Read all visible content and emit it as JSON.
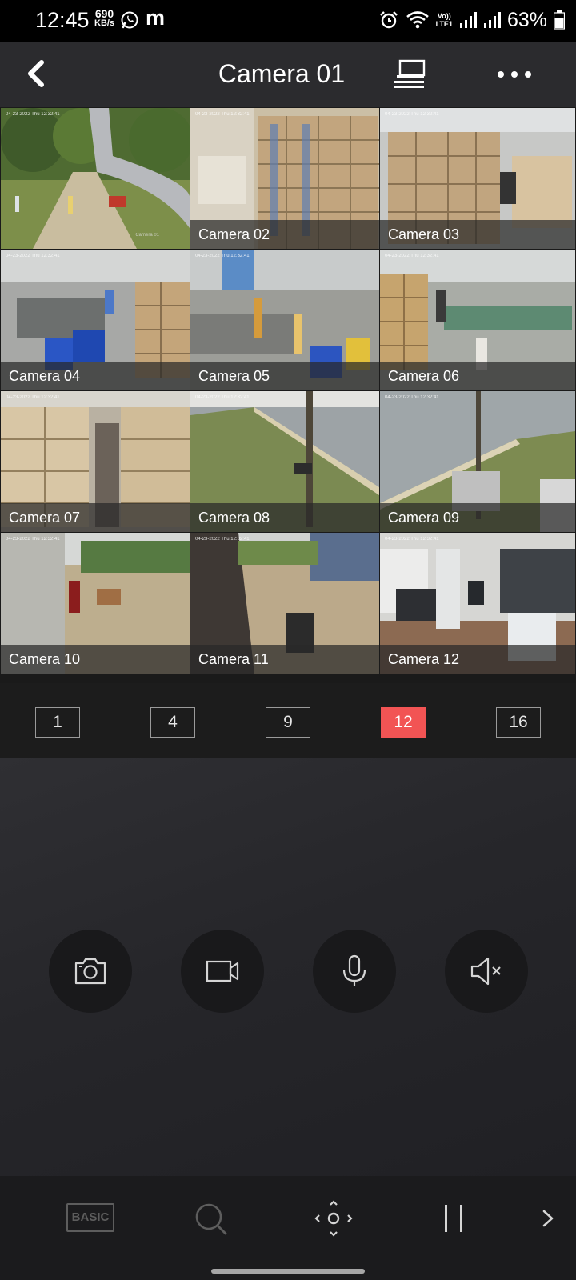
{
  "status_bar": {
    "time": "12:45",
    "net_speed_value": "690",
    "net_speed_unit": "KB/s",
    "app_icon_letter": "m",
    "volte_top": "Vo))",
    "volte_bottom": "LTE1",
    "battery": "63%"
  },
  "header": {
    "title": "Camera 01",
    "icons": [
      "back-icon",
      "monitor-icon",
      "more-icon"
    ]
  },
  "grid": {
    "selected": "Camera 01",
    "timestamp": "04-23-2022 Thu 12:32:41",
    "cells": [
      {
        "label": "",
        "watermark": "Camera 01"
      },
      {
        "label": "Camera 02",
        "watermark": "Camera 02"
      },
      {
        "label": "Camera 03",
        "watermark": "Camera 03"
      },
      {
        "label": "Camera 04",
        "watermark": "Camera 04"
      },
      {
        "label": "Camera 05",
        "watermark": "Camera 05"
      },
      {
        "label": "Camera 06",
        "watermark": "Camera 06"
      },
      {
        "label": "Camera 07",
        "watermark": "Camera 07"
      },
      {
        "label": "Camera 08",
        "watermark": "Camera 08"
      },
      {
        "label": "Camera 09",
        "watermark": "Camera 09"
      },
      {
        "label": "Camera 10",
        "watermark": "Camera 10"
      },
      {
        "label": "Camera 11",
        "watermark": "Camera 11"
      },
      {
        "label": "Camera 12",
        "watermark": "Camera 12"
      }
    ]
  },
  "layout_buttons": {
    "options": [
      "1",
      "4",
      "9",
      "12",
      "16"
    ],
    "active": "12",
    "active_color": "#f25454"
  },
  "controls": {
    "items": [
      "camera-icon",
      "video-record-icon",
      "microphone-icon",
      "speaker-mute-icon"
    ]
  },
  "toolbar": {
    "basic_label": "BASIC",
    "items": [
      "basic-mode-icon",
      "search-zoom-icon",
      "ptz-icon",
      "pause-icon",
      "chevron-right-icon"
    ]
  },
  "colors": {
    "accent": "#f25454",
    "header_bg": "#2b2b2e",
    "control_bg": "#2a2a2e"
  }
}
